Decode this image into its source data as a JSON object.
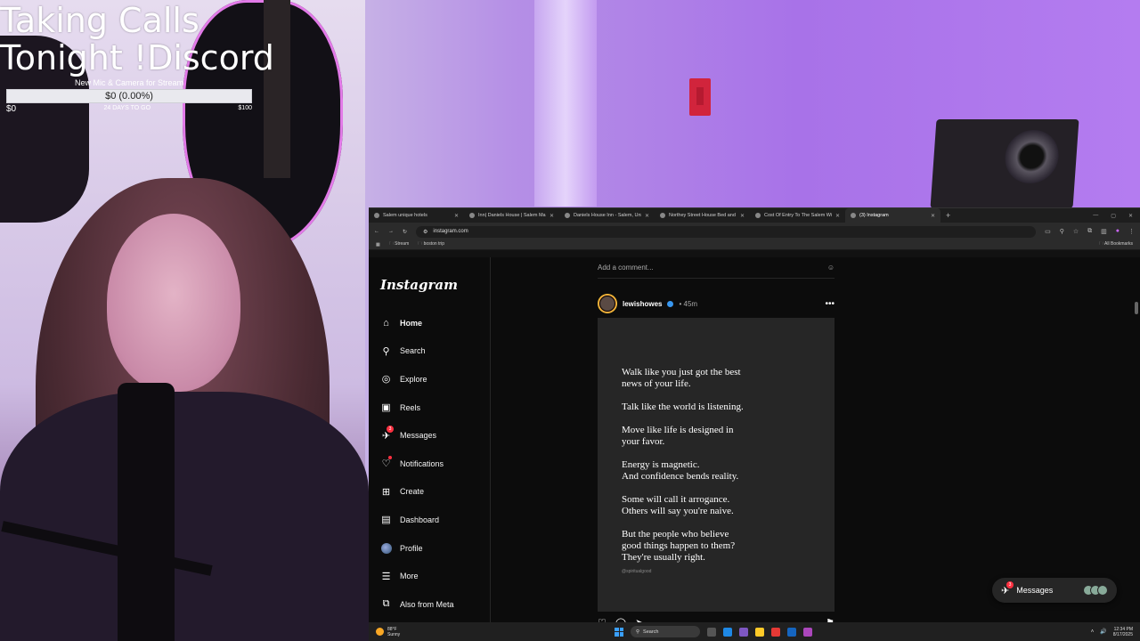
{
  "overlay": {
    "title_line1": "Taking Calls",
    "title_line2": "Tonight !Discord",
    "goal": {
      "title": "New Mic & Camera for Stream",
      "amount": "$0 (0.00%)",
      "progress_fraction": 0,
      "start": "$0",
      "days_left": "24 DAYS TO GO",
      "target": "$100"
    }
  },
  "browser": {
    "tabs": [
      {
        "title": "Salem unique hotels",
        "active": false
      },
      {
        "title": "Inn| Daniels House | Salem Ma",
        "active": false
      },
      {
        "title": "Daniels House Inn - Salem, Uni",
        "active": false
      },
      {
        "title": "Northey Street House Bed and",
        "active": false
      },
      {
        "title": "Cost Of Entry To The Salem Wi",
        "active": false
      },
      {
        "title": "(3) Instagram",
        "active": true
      }
    ],
    "url": "instagram.com",
    "bookmarks": [
      "Stream",
      "boston trip"
    ],
    "all_bookmarks": "All Bookmarks"
  },
  "instagram": {
    "logo": "Instagram",
    "nav": [
      {
        "label": "Home",
        "icon": "home-icon",
        "glyph": "⌂",
        "active": true
      },
      {
        "label": "Search",
        "icon": "search-icon",
        "glyph": "⚲"
      },
      {
        "label": "Explore",
        "icon": "compass-icon",
        "glyph": "◎"
      },
      {
        "label": "Reels",
        "icon": "reels-icon",
        "glyph": "▣"
      },
      {
        "label": "Messages",
        "icon": "messenger-icon",
        "glyph": "✈",
        "badge": "3"
      },
      {
        "label": "Notifications",
        "icon": "heart-icon",
        "glyph": "♡",
        "dot": true
      },
      {
        "label": "Create",
        "icon": "plus-square-icon",
        "glyph": "⊞"
      },
      {
        "label": "Dashboard",
        "icon": "dashboard-icon",
        "glyph": "▤"
      },
      {
        "label": "Profile",
        "icon": "profile-avatar",
        "glyph": ""
      },
      {
        "label": "More",
        "icon": "menu-icon",
        "glyph": "☰"
      },
      {
        "label": "Also from Meta",
        "icon": "meta-icon",
        "glyph": "⧉"
      }
    ],
    "comment_placeholder": "Add a comment...",
    "post": {
      "username": "lewishowes",
      "time": "• 45m",
      "lines": [
        "Walk like you just got the best\nnews of your life.",
        "Talk like the world is listening.",
        "Move like life is designed in\nyour favor.",
        "Energy is magnetic.\nAnd confidence bends reality.",
        "Some will call it arrogance.\nOthers will say you're naive.",
        "But the people who believe\ngood things happen to them?\nThey're usually right."
      ],
      "handle": "@spiritualgood"
    },
    "messages_pill": {
      "label": "Messages",
      "badge": "3"
    }
  },
  "taskbar": {
    "weather_temp": "88°F",
    "weather_desc": "Sunny",
    "search": "Search",
    "time": "12:34 PM",
    "date": "8/17/2025"
  }
}
